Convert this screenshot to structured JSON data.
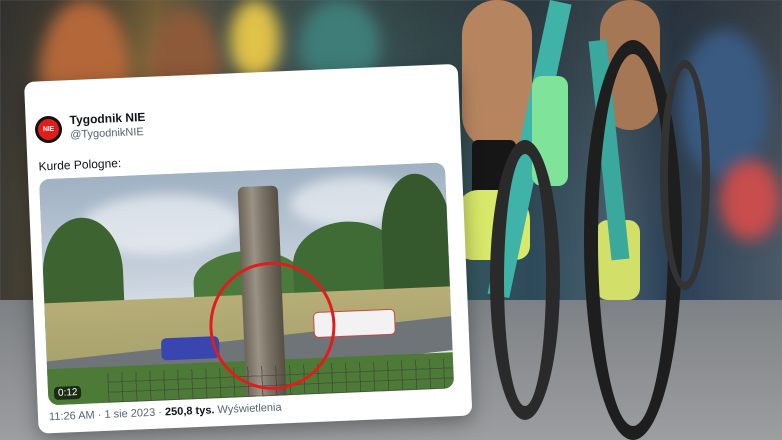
{
  "tweet": {
    "display_name": "Tygodnik NIE",
    "handle": "@TygodnikNIE",
    "avatar_text": "NIE",
    "text": "Kurde Pologne:",
    "video_time": "0:12",
    "time": "11:26 AM",
    "separator": "·",
    "date": "1 sie 2023",
    "views_count": "250,8 tys.",
    "views_label": "Wyświetlenia"
  },
  "colors": {
    "highlight_circle": "#e01c1c",
    "avatar_bg": "#e21b1b",
    "bike_frame": "#3fb3a8",
    "shoe": "#d8e86a"
  }
}
